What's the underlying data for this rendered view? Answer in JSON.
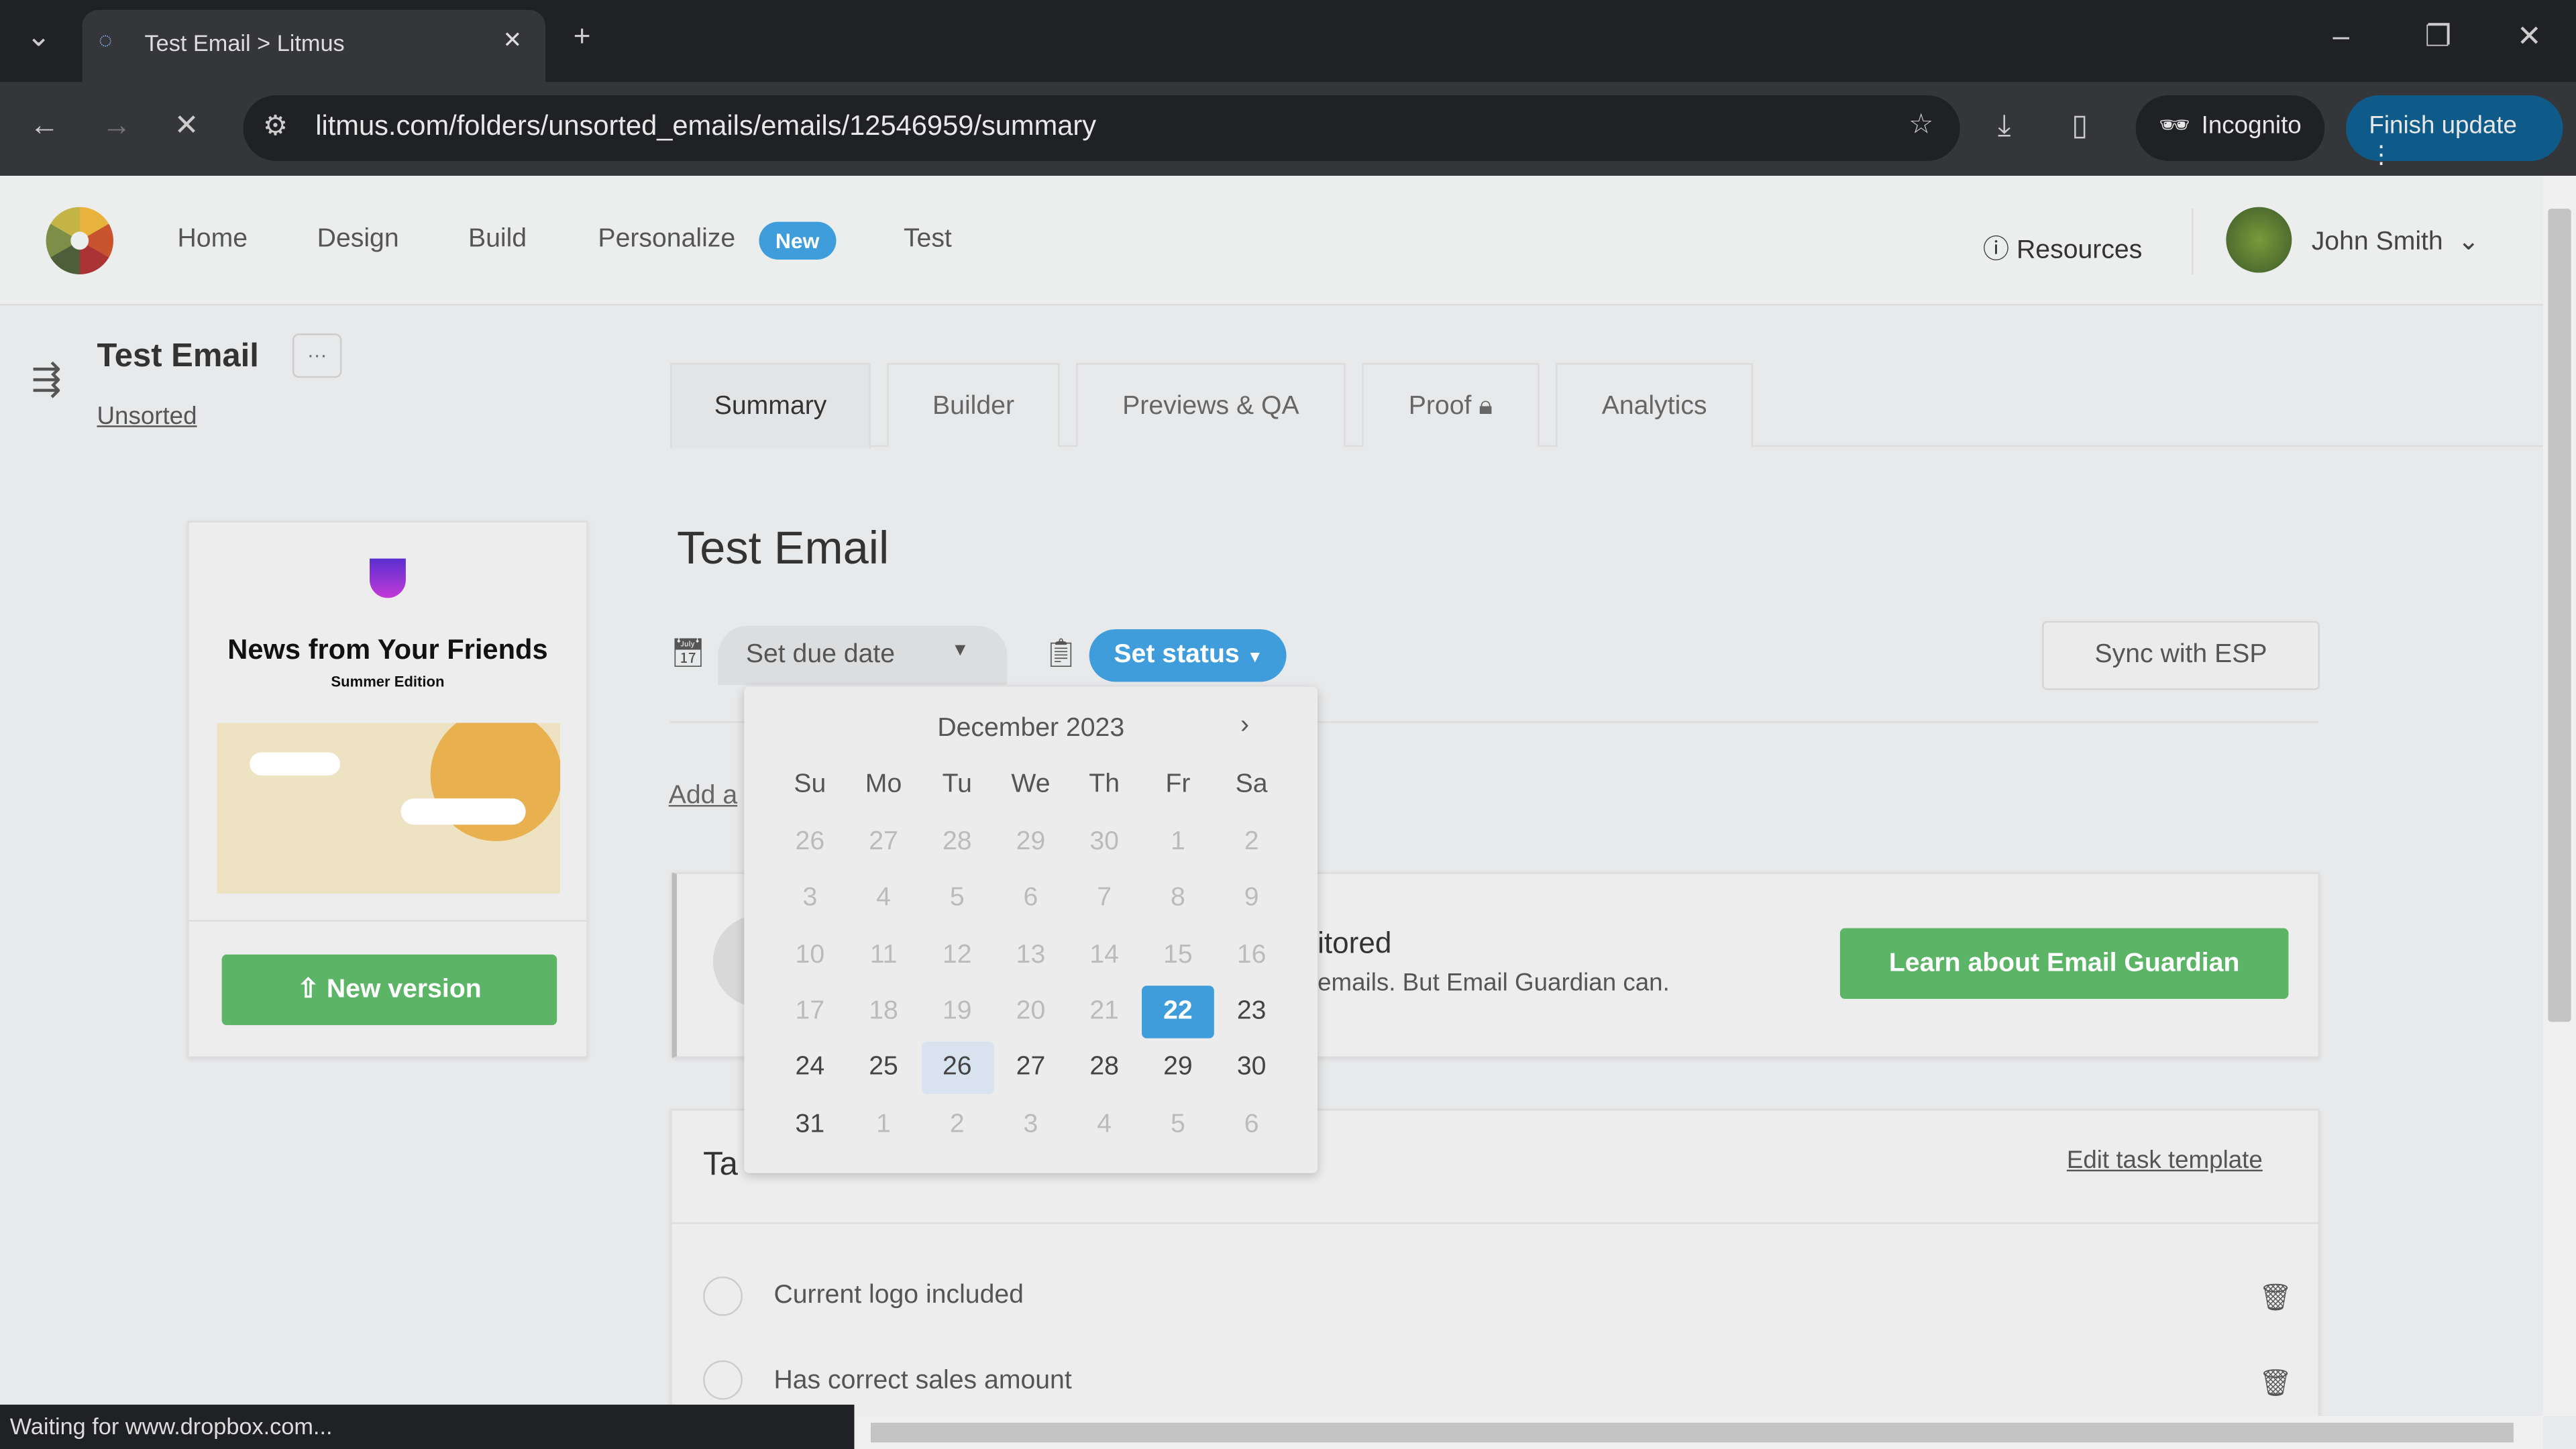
{
  "browser": {
    "tab_title": "Test Email > Litmus",
    "url": "litmus.com/folders/unsorted_emails/emails/12546959/summary",
    "incognito_label": "Incognito",
    "finish_update_label": "Finish update",
    "status_text": "Waiting for www.dropbox.com..."
  },
  "nav": {
    "items": [
      "Home",
      "Design",
      "Build",
      "Personalize",
      "Test"
    ],
    "new_badge": "New",
    "resources": "Resources",
    "user": "John Smith"
  },
  "email": {
    "title": "Test Email",
    "folder": "Unsorted",
    "more": "···"
  },
  "tabs": [
    "Summary",
    "Builder",
    "Previews & QA",
    "Proof",
    "Analytics"
  ],
  "preview": {
    "headline": "News from Your Friends",
    "subhead": "Summer Edition",
    "new_version": "New version"
  },
  "main": {
    "title": "Test Email",
    "due_date": "Set due date",
    "set_status": "Set status",
    "sync": "Sync with ESP",
    "add_link": "Add a",
    "guardian_title": "itored",
    "guardian_text": "emails. But Email Guardian can.",
    "guardian_button": "Learn about Email Guardian",
    "tasks_title": "Ta",
    "edit_template": "Edit task template",
    "tasks": [
      "Current logo included",
      "Has correct sales amount"
    ]
  },
  "calendar": {
    "month": "December 2023",
    "weekdays": [
      "Su",
      "Mo",
      "Tu",
      "We",
      "Th",
      "Fr",
      "Sa"
    ],
    "weeks": [
      [
        26,
        27,
        28,
        29,
        30,
        1,
        2
      ],
      [
        3,
        4,
        5,
        6,
        7,
        8,
        9
      ],
      [
        10,
        11,
        12,
        13,
        14,
        15,
        16
      ],
      [
        17,
        18,
        19,
        20,
        21,
        22,
        23
      ],
      [
        24,
        25,
        26,
        27,
        28,
        29,
        30
      ],
      [
        31,
        1,
        2,
        3,
        4,
        5,
        6
      ]
    ],
    "disabled": [
      [
        1,
        1,
        1,
        1,
        1,
        1,
        1
      ],
      [
        1,
        1,
        1,
        1,
        1,
        1,
        1
      ],
      [
        1,
        1,
        1,
        1,
        1,
        1,
        1
      ],
      [
        1,
        1,
        1,
        1,
        1,
        0,
        0
      ],
      [
        0,
        0,
        0,
        0,
        0,
        0,
        0
      ],
      [
        0,
        1,
        1,
        1,
        1,
        1,
        1
      ]
    ],
    "selected": 22,
    "hovered": 26
  },
  "colors": {
    "accent": "#3f9ddb",
    "green": "#5cb567"
  }
}
